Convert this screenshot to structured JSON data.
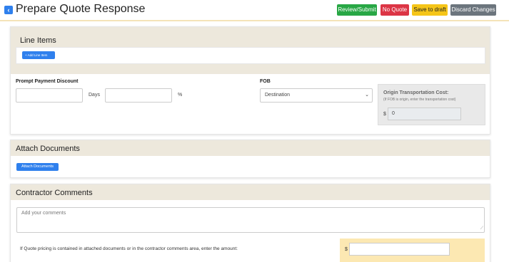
{
  "header": {
    "back_icon": "chevron-left-icon",
    "title": "Prepare Quote Response",
    "buttons": {
      "review": "Review/Submit",
      "no_quote": "No Quote",
      "draft": "Save to draft",
      "discard": "Discard Changes"
    },
    "colors": {
      "review": "#28a745",
      "no_quote": "#dc3545",
      "draft": "#f5c518",
      "discard": "#6c757d"
    }
  },
  "line_items": {
    "title": "Line Items",
    "add_button": "Add Line Item",
    "add_icon": "plus-icon"
  },
  "payment": {
    "discount_label": "Prompt Payment Discount",
    "days_label": "Days",
    "percent_label": "%",
    "discount_value": "",
    "days_value": ""
  },
  "fob": {
    "label": "FOB",
    "selected": "Destination",
    "chevron_icon": "chevron-down-icon"
  },
  "origin_cost": {
    "title": "Origin Transportation Cost:",
    "note": "(If FOB is origin, enter the transportation cost)",
    "currency": "$",
    "value": "0"
  },
  "attach": {
    "title": "Attach Documents",
    "button": "Attach Documents"
  },
  "comments": {
    "title": "Contractor Comments",
    "placeholder": "Add your comments",
    "pricing_text": "If Quote pricing is contained in attached documents or in the contractor comments area, enter the amount:",
    "currency": "$"
  }
}
